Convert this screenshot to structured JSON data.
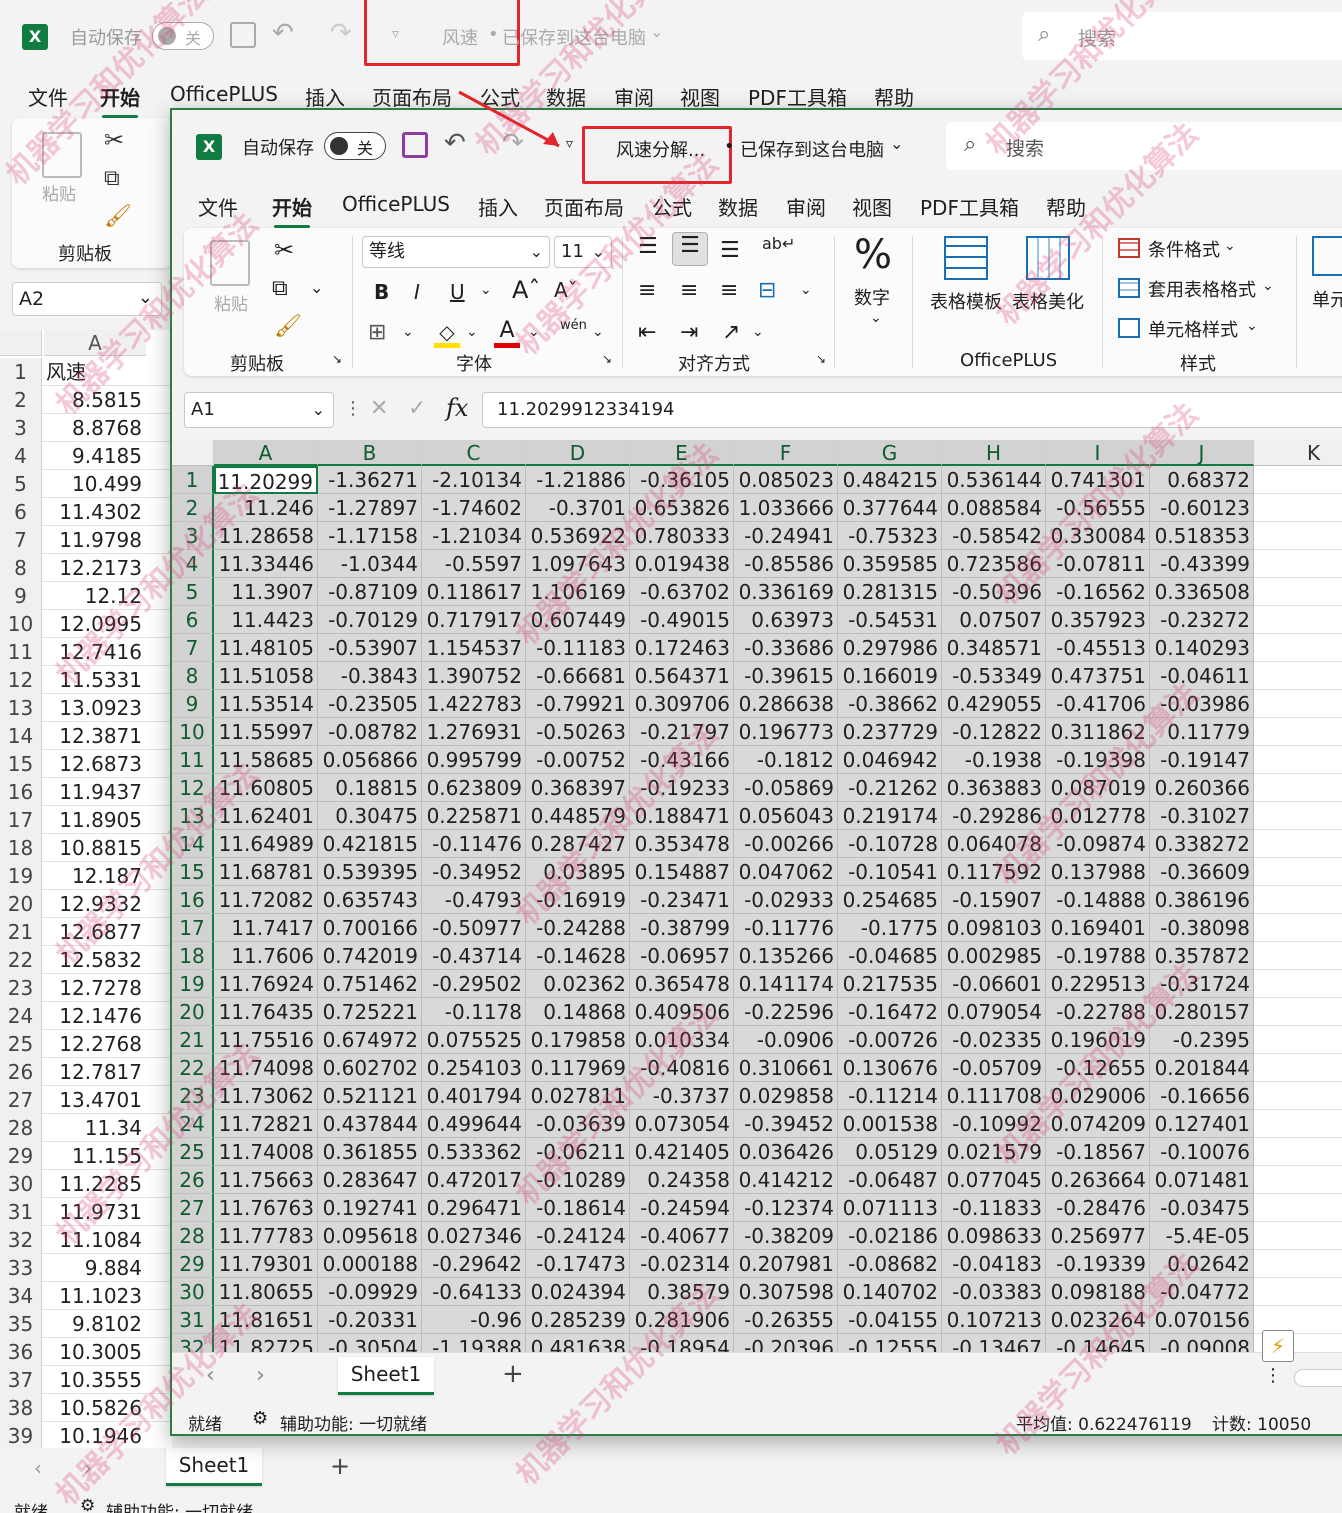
{
  "background_window": {
    "autosave_label": "自动保存",
    "autosave_state": "关",
    "doc_title": "风速",
    "saved_status": "已保存到这台电脑",
    "search_placeholder": "搜索",
    "menu": [
      "文件",
      "开始",
      "OfficePLUS",
      "插入",
      "页面布局",
      "公式",
      "数据",
      "审阅",
      "视图",
      "PDF工具箱",
      "帮助"
    ],
    "paste_label": "粘贴",
    "clipboard_label": "剪贴板",
    "name_box": "A2",
    "column_header": "A",
    "rows": [
      {
        "n": "1",
        "v": "风速"
      },
      {
        "n": "2",
        "v": "8.5815"
      },
      {
        "n": "3",
        "v": "8.8768"
      },
      {
        "n": "4",
        "v": "9.4185"
      },
      {
        "n": "5",
        "v": "10.499"
      },
      {
        "n": "6",
        "v": "11.4302"
      },
      {
        "n": "7",
        "v": "11.9798"
      },
      {
        "n": "8",
        "v": "12.2173"
      },
      {
        "n": "9",
        "v": "12.12"
      },
      {
        "n": "10",
        "v": "12.0995"
      },
      {
        "n": "11",
        "v": "12.7416"
      },
      {
        "n": "12",
        "v": "11.5331"
      },
      {
        "n": "13",
        "v": "13.0923"
      },
      {
        "n": "14",
        "v": "12.3871"
      },
      {
        "n": "15",
        "v": "12.6873"
      },
      {
        "n": "16",
        "v": "11.9437"
      },
      {
        "n": "17",
        "v": "11.8905"
      },
      {
        "n": "18",
        "v": "10.8815"
      },
      {
        "n": "19",
        "v": "12.187"
      },
      {
        "n": "20",
        "v": "12.9332"
      },
      {
        "n": "21",
        "v": "12.6877"
      },
      {
        "n": "22",
        "v": "12.5832"
      },
      {
        "n": "23",
        "v": "12.7278"
      },
      {
        "n": "24",
        "v": "12.1476"
      },
      {
        "n": "25",
        "v": "12.2768"
      },
      {
        "n": "26",
        "v": "12.7817"
      },
      {
        "n": "27",
        "v": "13.4701"
      },
      {
        "n": "28",
        "v": "11.34"
      },
      {
        "n": "29",
        "v": "11.155"
      },
      {
        "n": "30",
        "v": "11.2285"
      },
      {
        "n": "31",
        "v": "11.9731"
      },
      {
        "n": "32",
        "v": "11.1084"
      },
      {
        "n": "33",
        "v": "9.884"
      },
      {
        "n": "34",
        "v": "11.1023"
      },
      {
        "n": "35",
        "v": "9.8102"
      },
      {
        "n": "36",
        "v": "10.3005"
      },
      {
        "n": "37",
        "v": "10.3555"
      },
      {
        "n": "38",
        "v": "10.5826"
      },
      {
        "n": "39",
        "v": "10.1946"
      }
    ],
    "sheet_tab": "Sheet1",
    "status_ready": "就绪",
    "status_accessibility": "辅助功能: 一切就绪"
  },
  "foreground_window": {
    "autosave_label": "自动保存",
    "autosave_state": "关",
    "doc_title": "风速分解...",
    "saved_status": "已保存到这台电脑",
    "search_placeholder": "搜索",
    "menu": [
      "文件",
      "开始",
      "OfficePLUS",
      "插入",
      "页面布局",
      "公式",
      "数据",
      "审阅",
      "视图",
      "PDF工具箱",
      "帮助"
    ],
    "ribbon": {
      "paste_label": "粘贴",
      "clipboard_label": "剪贴板",
      "font_name": "等线",
      "font_size": "11",
      "font_label": "字体",
      "alignment_label": "对齐方式",
      "number_label": "数字",
      "table_template_label": "表格模板",
      "table_beautify_label": "表格美化",
      "officeplus_label": "OfficePLUS",
      "conditional_format_label": "条件格式",
      "table_format_label": "套用表格格式",
      "cell_style_label": "单元格样式",
      "styles_label": "样式",
      "cells_label": "单元"
    },
    "name_box": "A1",
    "formula": "11.2029912334194",
    "fx_label": "fx",
    "columns": [
      "A",
      "B",
      "C",
      "D",
      "E",
      "F",
      "G",
      "H",
      "I",
      "J",
      "K"
    ],
    "rows": [
      {
        "n": "1",
        "c": [
          "11.20299",
          "-1.36271",
          "-2.10134",
          "-1.21886",
          "-0.36105",
          "0.085023",
          "0.484215",
          "0.536144",
          "0.741301",
          "0.68372"
        ]
      },
      {
        "n": "2",
        "c": [
          "11.246",
          "-1.27897",
          "-1.74602",
          "-0.3701",
          "0.653826",
          "1.033666",
          "0.377644",
          "0.088584",
          "-0.56555",
          "-0.60123"
        ]
      },
      {
        "n": "3",
        "c": [
          "11.28658",
          "-1.17158",
          "-1.21034",
          "0.536922",
          "0.780333",
          "-0.24941",
          "-0.75323",
          "-0.58542",
          "0.330084",
          "0.518353"
        ]
      },
      {
        "n": "4",
        "c": [
          "11.33446",
          "-1.0344",
          "-0.5597",
          "1.097643",
          "0.019438",
          "-0.85586",
          "0.359585",
          "0.723586",
          "-0.07811",
          "-0.43399"
        ]
      },
      {
        "n": "5",
        "c": [
          "11.3907",
          "-0.87109",
          "0.118617",
          "1.106169",
          "-0.63702",
          "0.336169",
          "0.281315",
          "-0.50396",
          "-0.16562",
          "0.336508"
        ]
      },
      {
        "n": "6",
        "c": [
          "11.4423",
          "-0.70129",
          "0.717917",
          "0.607449",
          "-0.49015",
          "0.63973",
          "-0.54531",
          "0.07507",
          "0.357923",
          "-0.23272"
        ]
      },
      {
        "n": "7",
        "c": [
          "11.48105",
          "-0.53907",
          "1.154537",
          "-0.11183",
          "0.172463",
          "-0.33686",
          "0.297986",
          "0.348571",
          "-0.45513",
          "0.140293"
        ]
      },
      {
        "n": "8",
        "c": [
          "11.51058",
          "-0.3843",
          "1.390752",
          "-0.66681",
          "0.564371",
          "-0.39615",
          "0.166019",
          "-0.53349",
          "0.473751",
          "-0.04611"
        ]
      },
      {
        "n": "9",
        "c": [
          "11.53514",
          "-0.23505",
          "1.422783",
          "-0.79921",
          "0.309706",
          "0.286638",
          "-0.38662",
          "0.429055",
          "-0.41706",
          "-0.03986"
        ]
      },
      {
        "n": "10",
        "c": [
          "11.55997",
          "-0.08782",
          "1.276931",
          "-0.50263",
          "-0.21797",
          "0.196773",
          "0.237729",
          "-0.12822",
          "0.311862",
          "0.11779"
        ]
      },
      {
        "n": "11",
        "c": [
          "11.58685",
          "0.056866",
          "0.995799",
          "-0.00752",
          "-0.43166",
          "-0.1812",
          "0.046942",
          "-0.1938",
          "-0.19398",
          "-0.19147"
        ]
      },
      {
        "n": "12",
        "c": [
          "11.60805",
          "0.18815",
          "0.623809",
          "0.368397",
          "-0.19233",
          "-0.05869",
          "-0.21262",
          "0.363883",
          "0.087019",
          "0.260366"
        ]
      },
      {
        "n": "13",
        "c": [
          "11.62401",
          "0.30475",
          "0.225871",
          "0.448579",
          "0.188471",
          "0.056043",
          "0.219174",
          "-0.29286",
          "0.012778",
          "-0.31027"
        ]
      },
      {
        "n": "14",
        "c": [
          "11.64989",
          "0.421815",
          "-0.11476",
          "0.287427",
          "0.353478",
          "-0.00266",
          "-0.10728",
          "0.064078",
          "-0.09874",
          "0.338272"
        ]
      },
      {
        "n": "15",
        "c": [
          "11.68781",
          "0.539395",
          "-0.34952",
          "0.03895",
          "0.154887",
          "0.047062",
          "-0.10541",
          "0.117592",
          "0.137988",
          "-0.36609"
        ]
      },
      {
        "n": "16",
        "c": [
          "11.72082",
          "0.635743",
          "-0.4793",
          "-0.16919",
          "-0.23471",
          "-0.02933",
          "0.254685",
          "-0.15907",
          "-0.14888",
          "0.386196"
        ]
      },
      {
        "n": "17",
        "c": [
          "11.7417",
          "0.700166",
          "-0.50977",
          "-0.24288",
          "-0.38799",
          "-0.11776",
          "-0.1775",
          "0.098103",
          "0.169401",
          "-0.38098"
        ]
      },
      {
        "n": "18",
        "c": [
          "11.7606",
          "0.742019",
          "-0.43714",
          "-0.14628",
          "-0.06957",
          "0.135266",
          "-0.04685",
          "0.002985",
          "-0.19788",
          "0.357872"
        ]
      },
      {
        "n": "19",
        "c": [
          "11.76924",
          "0.751462",
          "-0.29502",
          "0.02362",
          "0.365478",
          "0.141174",
          "0.217535",
          "-0.06601",
          "0.229513",
          "-0.31724"
        ]
      },
      {
        "n": "20",
        "c": [
          "11.76435",
          "0.725221",
          "-0.1178",
          "0.14868",
          "0.409506",
          "-0.22596",
          "-0.16472",
          "0.079054",
          "-0.22788",
          "0.280157"
        ]
      },
      {
        "n": "21",
        "c": [
          "11.75516",
          "0.674972",
          "0.075525",
          "0.179858",
          "0.010334",
          "-0.0906",
          "-0.00726",
          "-0.02335",
          "0.196019",
          "-0.2395"
        ]
      },
      {
        "n": "22",
        "c": [
          "11.74098",
          "0.602702",
          "0.254103",
          "0.117969",
          "-0.40816",
          "0.310661",
          "0.130676",
          "-0.05709",
          "-0.12655",
          "0.201844"
        ]
      },
      {
        "n": "23",
        "c": [
          "11.73062",
          "0.521121",
          "0.401794",
          "0.027811",
          "-0.3737",
          "0.029858",
          "-0.11214",
          "0.111708",
          "0.029006",
          "-0.16656"
        ]
      },
      {
        "n": "24",
        "c": [
          "11.72821",
          "0.437844",
          "0.499644",
          "-0.03639",
          "0.073054",
          "-0.39452",
          "0.001538",
          "-0.10992",
          "0.074209",
          "0.127401"
        ]
      },
      {
        "n": "25",
        "c": [
          "11.74008",
          "0.361855",
          "0.533362",
          "-0.06211",
          "0.421405",
          "0.036426",
          "0.05129",
          "0.021579",
          "-0.18567",
          "-0.10076"
        ]
      },
      {
        "n": "26",
        "c": [
          "11.75663",
          "0.283647",
          "0.472017",
          "-0.10289",
          "0.24358",
          "0.414212",
          "-0.06487",
          "0.077045",
          "0.263664",
          "0.071481"
        ]
      },
      {
        "n": "27",
        "c": [
          "11.76763",
          "0.192741",
          "0.296471",
          "-0.18614",
          "-0.24594",
          "-0.12374",
          "0.071113",
          "-0.11833",
          "-0.28476",
          "-0.03475"
        ]
      },
      {
        "n": "28",
        "c": [
          "11.77783",
          "0.095618",
          "0.027346",
          "-0.24124",
          "-0.40677",
          "-0.38209",
          "-0.02186",
          "0.098633",
          "0.256977",
          "-5.4E-05"
        ]
      },
      {
        "n": "29",
        "c": [
          "11.79301",
          "0.000188",
          "-0.29642",
          "-0.17473",
          "-0.02314",
          "0.207981",
          "-0.08682",
          "-0.04183",
          "-0.19339",
          "0.02642"
        ]
      },
      {
        "n": "30",
        "c": [
          "11.80655",
          "-0.09929",
          "-0.64133",
          "0.024394",
          "0.38579",
          "0.307598",
          "0.140702",
          "-0.03383",
          "0.098188",
          "-0.04772"
        ]
      },
      {
        "n": "31",
        "c": [
          "11.81651",
          "-0.20331",
          "-0.96",
          "0.285239",
          "0.281906",
          "-0.26355",
          "-0.04155",
          "0.107213",
          "0.023264",
          "0.070156"
        ]
      },
      {
        "n": "32",
        "c": [
          "11.82725",
          "-0.30504",
          "-1.19388",
          "0.481638",
          "-0.18954",
          "-0.20396",
          "-0.12555",
          "-0.13467",
          "-0.14645",
          "-0.09008"
        ]
      }
    ],
    "sheet_tab": "Sheet1",
    "status_ready": "就绪",
    "status_accessibility": "辅助功能: 一切就绪",
    "status_average": "平均值: 0.622476119",
    "status_count": "计数: 10050"
  },
  "watermark": "机器学习和优化算法",
  "colors": {
    "excel_green": "#107c41",
    "highlight_red": "#e3262b",
    "selection_gray": "#d9d9d9"
  }
}
